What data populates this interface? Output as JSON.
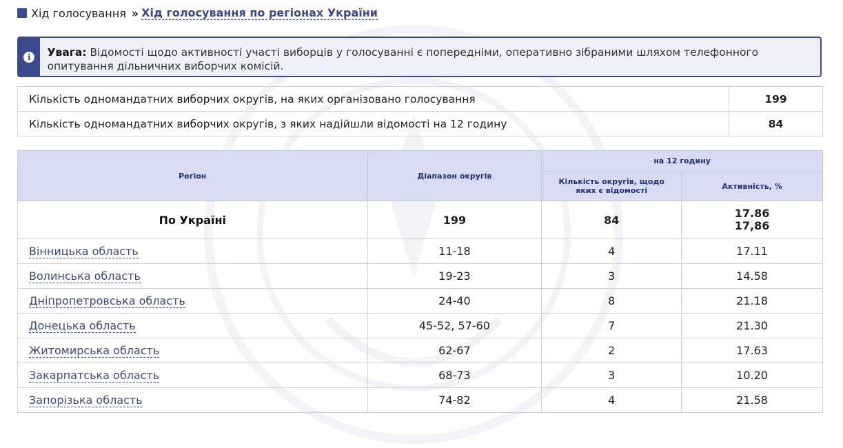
{
  "breadcrumb": {
    "home": "Хід голосування",
    "separator": "»",
    "current": "Хід голосування по регіонах України"
  },
  "alert": {
    "icon": "i",
    "label": "Увага:",
    "text": "Відомості щодо активності участі виборців у голосуванні є попередніми, оперативно зібраними шляхом телефонного опитування дільничних виборчих комісій."
  },
  "summary": [
    {
      "label": "Кількість одномандатних виборчих округів, на яких організовано голосування",
      "value": "199"
    },
    {
      "label": "Кількість одномандатних виборчих округів, з яких надійшли відомості на 12 годину",
      "value": "84"
    }
  ],
  "table": {
    "headers": {
      "region": "Регіон",
      "range": "Діапазон округів",
      "time_group": "на 12 годину",
      "count": "Кількість округів, щодо яких є відомості",
      "activity": "Активність, %"
    },
    "total": {
      "region": "По Україні",
      "range": "199",
      "count": "84",
      "activity_a": "17.86",
      "activity_b": "17,86"
    },
    "rows": [
      {
        "region": "Вінницька область",
        "range": "11-18",
        "count": "4",
        "activity": "17.11"
      },
      {
        "region": "Волинська область",
        "range": "19-23",
        "count": "3",
        "activity": "14.58"
      },
      {
        "region": "Дніпропетровська область",
        "range": "24-40",
        "count": "8",
        "activity": "21.18"
      },
      {
        "region": "Донецька область",
        "range": "45-52, 57-60",
        "count": "7",
        "activity": "21.30"
      },
      {
        "region": "Житомирська область",
        "range": "62-67",
        "count": "2",
        "activity": "17.63"
      },
      {
        "region": "Закарпатська область",
        "range": "68-73",
        "count": "3",
        "activity": "10.20"
      },
      {
        "region": "Запорізька область",
        "range": "74-82",
        "count": "4",
        "activity": "21.58"
      }
    ]
  },
  "colors": {
    "accent": "#3a4a8c",
    "header_bg": "#d7dcf3",
    "alert_bg": "#eef0fb"
  }
}
